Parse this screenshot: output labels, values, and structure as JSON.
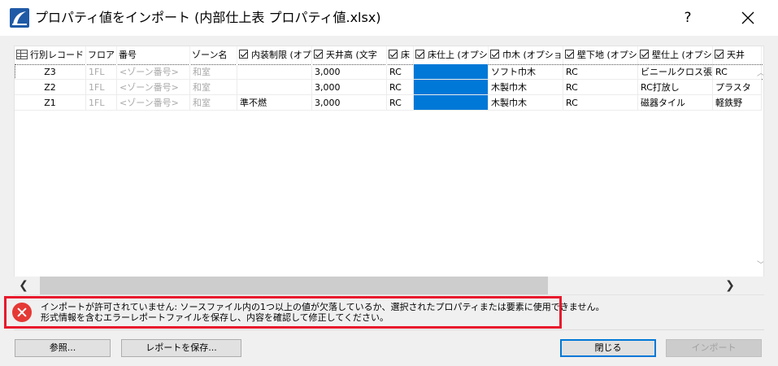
{
  "window": {
    "title": "プロパティ値をインポート (内部仕上表 プロパティ値.xlsx)",
    "help_label": "?"
  },
  "grid": {
    "columns": [
      {
        "label": "行別レコード",
        "checkbox": false
      },
      {
        "label": "フロア",
        "checkbox": false
      },
      {
        "label": "番号",
        "checkbox": false
      },
      {
        "label": "ゾーン名",
        "checkbox": false
      },
      {
        "label": "内装制限 (オプ",
        "checkbox": true
      },
      {
        "label": "天井高 (文字",
        "checkbox": true
      },
      {
        "label": "床",
        "checkbox": true
      },
      {
        "label": "床仕上 (オプシ",
        "checkbox": true
      },
      {
        "label": "巾木 (オプショ",
        "checkbox": true
      },
      {
        "label": "壁下地 (オプシ",
        "checkbox": true
      },
      {
        "label": "壁仕上 (オプシ",
        "checkbox": true
      },
      {
        "label": "天井",
        "checkbox": true
      }
    ],
    "rows": [
      {
        "id": "Z3",
        "floor": "1FL",
        "number": "<ゾーン番号>",
        "zone": "和室",
        "restriction": "",
        "ceiling_height": "3,000",
        "floor_base": "RC",
        "floor_finish": "",
        "baseboard": "ソフト巾木",
        "wall_base": "RC",
        "wall_finish": "ビニールクロス張",
        "ceiling": "RC"
      },
      {
        "id": "Z2",
        "floor": "1FL",
        "number": "<ゾーン番号>",
        "zone": "和室",
        "restriction": "",
        "ceiling_height": "3,000",
        "floor_base": "RC",
        "floor_finish": "",
        "baseboard": "木製巾木",
        "wall_base": "RC",
        "wall_finish": "RC打放し",
        "ceiling": "プラスタ"
      },
      {
        "id": "Z1",
        "floor": "1FL",
        "number": "<ゾーン番号>",
        "zone": "和室",
        "restriction": "準不燃",
        "ceiling_height": "3,000",
        "floor_base": "RC",
        "floor_finish": "",
        "baseboard": "木製巾木",
        "wall_base": "RC",
        "wall_finish": "磁器タイル",
        "ceiling": "軽鉄野"
      }
    ]
  },
  "error": {
    "line1": "インポートが許可されていません: ソースファイル内の1つ以上の値が欠落しているか、選択されたプロパティまたは要素に使用できません。",
    "line2": "形式情報を含むエラーレポートファイルを保存し、内容を確認して修正してください。"
  },
  "buttons": {
    "browse": "参照...",
    "save_report": "レポートを保存...",
    "close": "閉じる",
    "import": "インポート"
  },
  "colors": {
    "selection_blue": "#0078d7",
    "error_border": "#e8192c",
    "error_icon": "#e53935"
  }
}
